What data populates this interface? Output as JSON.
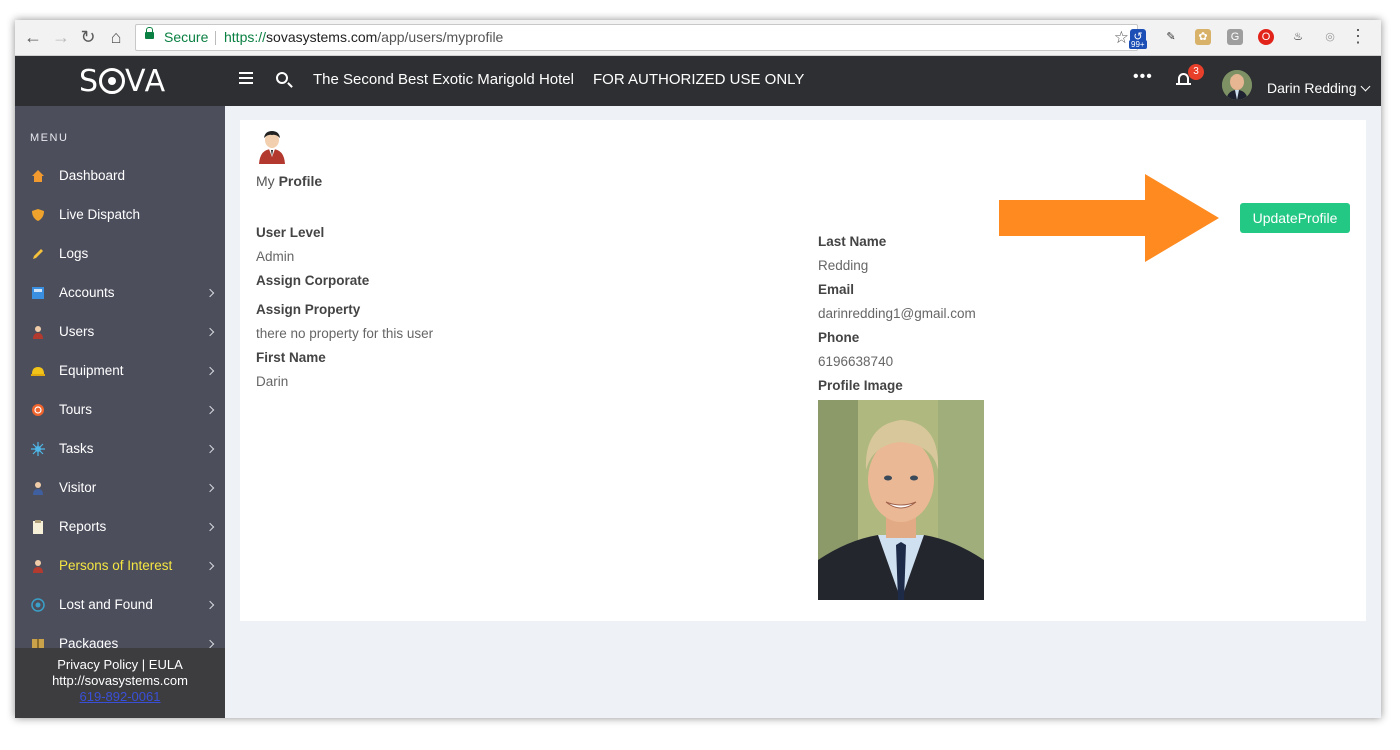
{
  "browser": {
    "secure_label": "Secure",
    "url_proto": "https://",
    "url_host": "sovasystems.com",
    "url_path": "/app/users/myprofile",
    "ext_badge": "99+"
  },
  "header": {
    "logo": "S",
    "logo_rest": "VA",
    "hotel_name": "The Second Best Exotic Marigold Hotel",
    "notice": "FOR AUTHORIZED USE ONLY",
    "more": "•••",
    "notification_count": "3",
    "user_name": "Darin Redding"
  },
  "sidebar": {
    "menu_title": "MENU",
    "items": [
      {
        "label": "Dashboard",
        "icon": "home-icon",
        "color": "#f29a2e"
      },
      {
        "label": "Live Dispatch",
        "icon": "shield-icon",
        "color": "#f0a32c"
      },
      {
        "label": "Logs",
        "icon": "pencil-icon",
        "color": "#f5c13a"
      },
      {
        "label": "Accounts",
        "icon": "accounts-icon",
        "color": "#3b8fe0"
      },
      {
        "label": "Users",
        "icon": "user-icon",
        "color": "#b33a2e"
      },
      {
        "label": "Equipment",
        "icon": "helmet-icon",
        "color": "#f2c318"
      },
      {
        "label": "Tours",
        "icon": "compass-icon",
        "color": "#f0652e"
      },
      {
        "label": "Tasks",
        "icon": "tasks-icon",
        "color": "#4fb6e8"
      },
      {
        "label": "Visitor",
        "icon": "visitor-icon",
        "color": "#3f5f9e"
      },
      {
        "label": "Reports",
        "icon": "clipboard-icon",
        "color": "#f6f0d8"
      },
      {
        "label": "Persons of Interest",
        "icon": "person-icon",
        "color": "#b33a2e"
      },
      {
        "label": "Lost and Found",
        "icon": "target-icon",
        "color": "#3aa0c8"
      },
      {
        "label": "Packages",
        "icon": "package-icon",
        "color": "#c9a24a"
      }
    ],
    "footer_privacy": "Privacy Policy",
    "footer_sep": "|",
    "footer_eula": "EULA",
    "footer_site": "http://sovasystems.com",
    "footer_phone": "619-892-0061"
  },
  "profile": {
    "heading_prefix": "My",
    "heading_bold": "Profile",
    "update_button": "UpdateProfile",
    "user_level_label": "User Level",
    "user_level_value": "Admin",
    "assign_corporate_label": "Assign Corporate",
    "assign_property_label": "Assign Property",
    "assign_property_value": "there no property for this user",
    "first_name_label": "First Name",
    "first_name_value": "Darin",
    "last_name_label": "Last Name",
    "last_name_value": "Redding",
    "email_label": "Email",
    "email_value": "darinredding1@gmail.com",
    "phone_label": "Phone",
    "phone_value": "6196638740",
    "profile_image_label": "Profile Image"
  },
  "annotation": {
    "arrow_color": "#ff8a1f"
  }
}
